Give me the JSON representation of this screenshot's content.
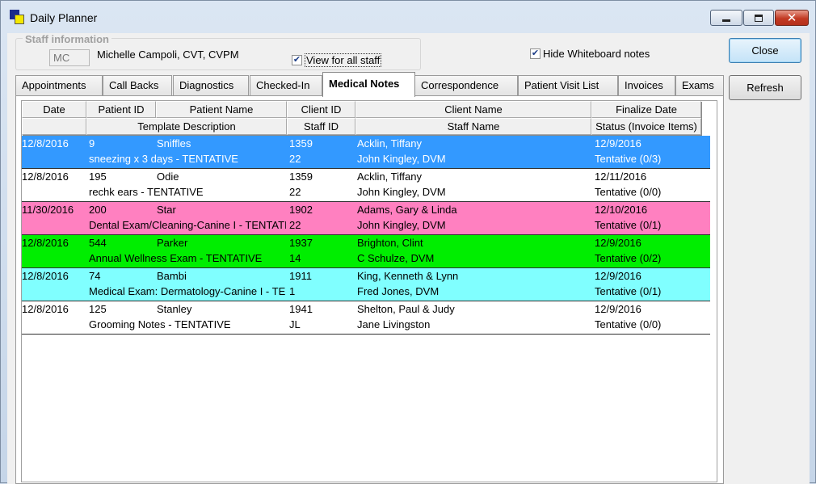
{
  "window": {
    "title": "Daily Planner"
  },
  "staff": {
    "group_label": "Staff information",
    "initials": "MC",
    "name": "Michelle Campoli, CVT, CVPM",
    "view_all_label": "View for all staff",
    "view_all_checked": true,
    "hide_whiteboard_label": "Hide Whiteboard notes",
    "hide_whiteboard_checked": true
  },
  "buttons": {
    "close": "Close",
    "refresh": "Refresh"
  },
  "tabs": [
    {
      "label": "Appointments",
      "active": false
    },
    {
      "label": "Call Backs",
      "active": false
    },
    {
      "label": "Diagnostics",
      "active": false
    },
    {
      "label": "Checked-In",
      "active": false
    },
    {
      "label": "Medical Notes",
      "active": true
    },
    {
      "label": "Correspondence",
      "active": false
    },
    {
      "label": "Patient Visit List",
      "active": false
    },
    {
      "label": "Invoices",
      "active": false
    },
    {
      "label": "Exams",
      "active": false
    }
  ],
  "grid": {
    "header_row1": [
      "Date",
      "Patient ID",
      "Patient Name",
      "Client ID",
      "Client Name",
      "Finalize Date"
    ],
    "header_row2": [
      "",
      "Template Description",
      "Staff ID",
      "Staff Name",
      "Status (Invoice Items)"
    ],
    "rows": [
      {
        "date": "12/8/2016",
        "patient_id": "9",
        "patient_name": "Sniffles",
        "client_id": "1359",
        "client_name": "Acklin, Tiffany",
        "finalize_date": "12/9/2016",
        "template": "sneezing x 3 days - TENTATIVE",
        "staff_id": "22",
        "staff_name": "John Kingley, DVM",
        "status": "Tentative (0/3)",
        "bg": "#3399ff",
        "fg": "#ffffff"
      },
      {
        "date": "12/8/2016",
        "patient_id": "195",
        "patient_name": "Odie",
        "client_id": "1359",
        "client_name": "Acklin, Tiffany",
        "finalize_date": "12/11/2016",
        "template": "rechk ears - TENTATIVE",
        "staff_id": "22",
        "staff_name": "John Kingley, DVM",
        "status": "Tentative (0/0)",
        "bg": "#ffffff",
        "fg": "#000000"
      },
      {
        "date": "11/30/2016",
        "patient_id": "200",
        "patient_name": "Star",
        "client_id": "1902",
        "client_name": "Adams, Gary & Linda",
        "finalize_date": "12/10/2016",
        "template": "Dental Exam/Cleaning-Canine I - TENTATIVE",
        "staff_id": "22",
        "staff_name": "John Kingley, DVM",
        "status": "Tentative (0/1)",
        "bg": "#ff80c0",
        "fg": "#000000"
      },
      {
        "date": "12/8/2016",
        "patient_id": "544",
        "patient_name": "Parker",
        "client_id": "1937",
        "client_name": "Brighton, Clint",
        "finalize_date": "12/9/2016",
        "template": "Annual Wellness Exam  - TENTATIVE",
        "staff_id": "14",
        "staff_name": "C Schulze, DVM",
        "status": "Tentative (0/2)",
        "bg": "#00ee00",
        "fg": "#000000"
      },
      {
        "date": "12/8/2016",
        "patient_id": "74",
        "patient_name": "Bambi",
        "client_id": "1911",
        "client_name": "King, Kenneth & Lynn",
        "finalize_date": "12/9/2016",
        "template": "Medical Exam:  Dermatology-Canine I - TENTATIVE",
        "staff_id": "1",
        "staff_name": "Fred Jones, DVM",
        "status": "Tentative (0/1)",
        "bg": "#80ffff",
        "fg": "#000000"
      },
      {
        "date": "12/8/2016",
        "patient_id": "125",
        "patient_name": "Stanley",
        "client_id": "1941",
        "client_name": "Shelton, Paul & Judy",
        "finalize_date": "12/9/2016",
        "template": "Grooming Notes - TENTATIVE",
        "staff_id": "JL",
        "staff_name": "Jane Livingston",
        "status": "Tentative (0/0)",
        "bg": "#ffffff",
        "fg": "#000000"
      }
    ]
  }
}
